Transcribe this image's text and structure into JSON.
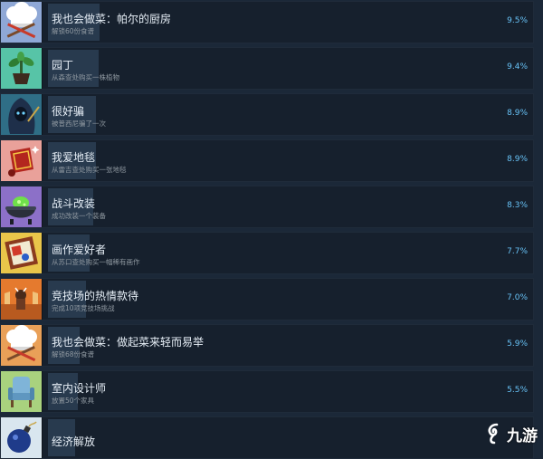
{
  "achievements": [
    {
      "title": "我也会做菜：帕尔的厨房",
      "desc": "解锁60份食谱",
      "pct": "9.5%",
      "progress": 0.095,
      "icon": "chef-hat-icon",
      "bg": "#8fa8d6"
    },
    {
      "title": "园丁",
      "desc": "从森查处购买一株植物",
      "pct": "9.4%",
      "progress": 0.094,
      "icon": "potted-plant-icon",
      "bg": "#57c4a7"
    },
    {
      "title": "很好骗",
      "desc": "被普西尼骗了一次",
      "pct": "8.9%",
      "progress": 0.089,
      "icon": "hooded-figure-icon",
      "bg": "#2f6e86"
    },
    {
      "title": "我爱地毯",
      "desc": "从雷吉查处购买一张地毯",
      "pct": "8.9%",
      "progress": 0.089,
      "icon": "carpet-icon",
      "bg": "#e9a19a"
    },
    {
      "title": "战斗改装",
      "desc": "成功改装一个装备",
      "pct": "8.3%",
      "progress": 0.083,
      "icon": "cauldron-icon",
      "bg": "#8c70c8"
    },
    {
      "title": "画作爱好者",
      "desc": "从苏口查处购买一幅稀有画作",
      "pct": "7.7%",
      "progress": 0.077,
      "icon": "painting-icon",
      "bg": "#e9c64a"
    },
    {
      "title": "竞技场的热情款待",
      "desc": "完成10项竞技场挑战",
      "pct": "7.0%",
      "progress": 0.07,
      "icon": "arena-icon",
      "bg": "#e57a2e"
    },
    {
      "title": "我也会做菜：做起菜来轻而易举",
      "desc": "解锁68份食谱",
      "pct": "5.9%",
      "progress": 0.059,
      "icon": "chef-hat-icon",
      "bg": "#e9a058"
    },
    {
      "title": "室内设计师",
      "desc": "放置50个家具",
      "pct": "5.5%",
      "progress": 0.055,
      "icon": "armchair-icon",
      "bg": "#a9d27e"
    },
    {
      "title": "经济解放",
      "desc": "",
      "pct": "",
      "progress": 0.05,
      "icon": "bomb-icon",
      "bg": "#d9e6ef"
    }
  ],
  "watermark": {
    "text": "九游"
  }
}
